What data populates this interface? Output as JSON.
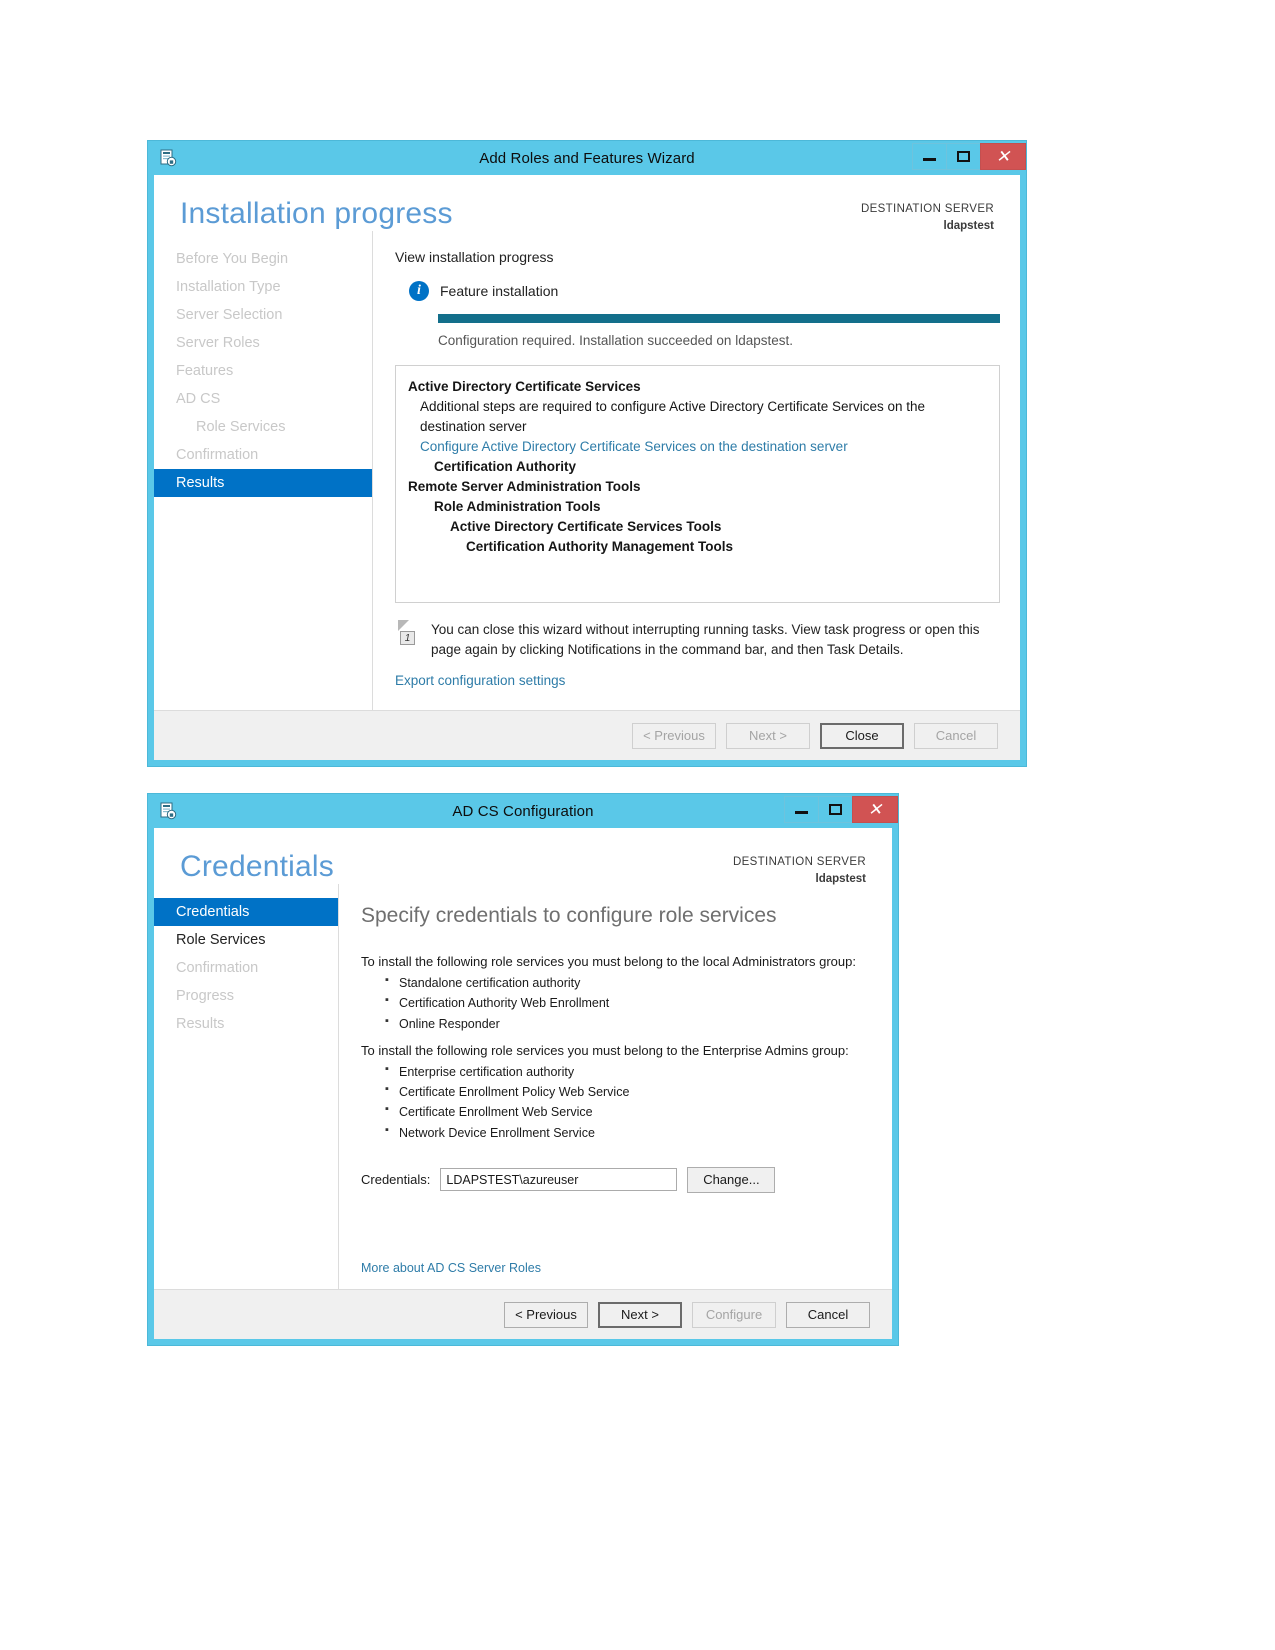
{
  "window1": {
    "title": "Add Roles and Features Wizard",
    "icon": "server-wizard-icon",
    "controls": {
      "minimize": "–",
      "maximize": "□",
      "close": "✕"
    },
    "page_title": "Installation progress",
    "destination": {
      "label": "DESTINATION SERVER",
      "server": "ldapstest"
    },
    "nav": [
      {
        "label": "Before You Begin",
        "state": "done"
      },
      {
        "label": "Installation Type",
        "state": "done"
      },
      {
        "label": "Server Selection",
        "state": "done"
      },
      {
        "label": "Server Roles",
        "state": "done"
      },
      {
        "label": "Features",
        "state": "done"
      },
      {
        "label": "AD CS",
        "state": "done"
      },
      {
        "label": "Role Services",
        "state": "done-sub"
      },
      {
        "label": "Confirmation",
        "state": "done"
      },
      {
        "label": "Results",
        "state": "active"
      }
    ],
    "lead": "View installation progress",
    "feature_label": "Feature installation",
    "progress_percent": 100,
    "progress_message": "Configuration required. Installation succeeded on ldapstest.",
    "results_tree": [
      {
        "text": "Active Directory Certificate Services",
        "indent": 0,
        "style": "bold"
      },
      {
        "text": "Additional steps are required to configure Active Directory Certificate Services on the destination server",
        "indent": 1,
        "style": "normal"
      },
      {
        "text": "Configure Active Directory Certificate Services on the destination server",
        "indent": 1,
        "style": "link"
      },
      {
        "text": "Certification Authority",
        "indent": 2,
        "style": "bold"
      },
      {
        "text": "Remote Server Administration Tools",
        "indent": 0,
        "style": "bold"
      },
      {
        "text": "Role Administration Tools",
        "indent": 2,
        "style": "bold"
      },
      {
        "text": "Active Directory Certificate Services Tools",
        "indent": 3,
        "style": "bold"
      },
      {
        "text": "Certification Authority Management Tools",
        "indent": 4,
        "style": "bold"
      }
    ],
    "notice": "You can close this wizard without interrupting running tasks. View task progress or open this page again by clicking Notifications in the command bar, and then Task Details.",
    "notice_badge": "1",
    "export_link": "Export configuration settings",
    "buttons": {
      "previous": "< Previous",
      "next": "Next >",
      "close": "Close",
      "cancel": "Cancel"
    }
  },
  "window2": {
    "title": "AD CS Configuration",
    "icon": "server-wizard-icon",
    "controls": {
      "minimize": "–",
      "maximize": "□",
      "close": "✕"
    },
    "page_title": "Credentials",
    "destination": {
      "label": "DESTINATION SERVER",
      "server": "ldapstest"
    },
    "nav": [
      {
        "label": "Credentials",
        "state": "active"
      },
      {
        "label": "Role Services",
        "state": "enabled"
      },
      {
        "label": "Confirmation",
        "state": "done"
      },
      {
        "label": "Progress",
        "state": "done"
      },
      {
        "label": "Results",
        "state": "done"
      }
    ],
    "heading": "Specify credentials to configure role services",
    "paragraph1": "To install the following role services you must belong to the local Administrators group:",
    "list1": [
      "Standalone certification authority",
      "Certification Authority Web Enrollment",
      "Online Responder"
    ],
    "paragraph2": "To install the following role services you must belong to the Enterprise Admins group:",
    "list2": [
      "Enterprise certification authority",
      "Certificate Enrollment Policy Web Service",
      "Certificate Enrollment Web Service",
      "Network Device Enrollment Service"
    ],
    "credentials_label": "Credentials:",
    "credentials_value": "LDAPSTEST\\azureuser",
    "change_button": "Change...",
    "more_link": "More about AD CS Server Roles",
    "buttons": {
      "previous": "< Previous",
      "next": "Next >",
      "configure": "Configure",
      "cancel": "Cancel"
    }
  },
  "colors": {
    "title_bar": "#5ac8e8",
    "accent_blue": "#0072c6",
    "link": "#2e7ca8",
    "progress": "#136f8b",
    "close_red": "#d15353"
  }
}
